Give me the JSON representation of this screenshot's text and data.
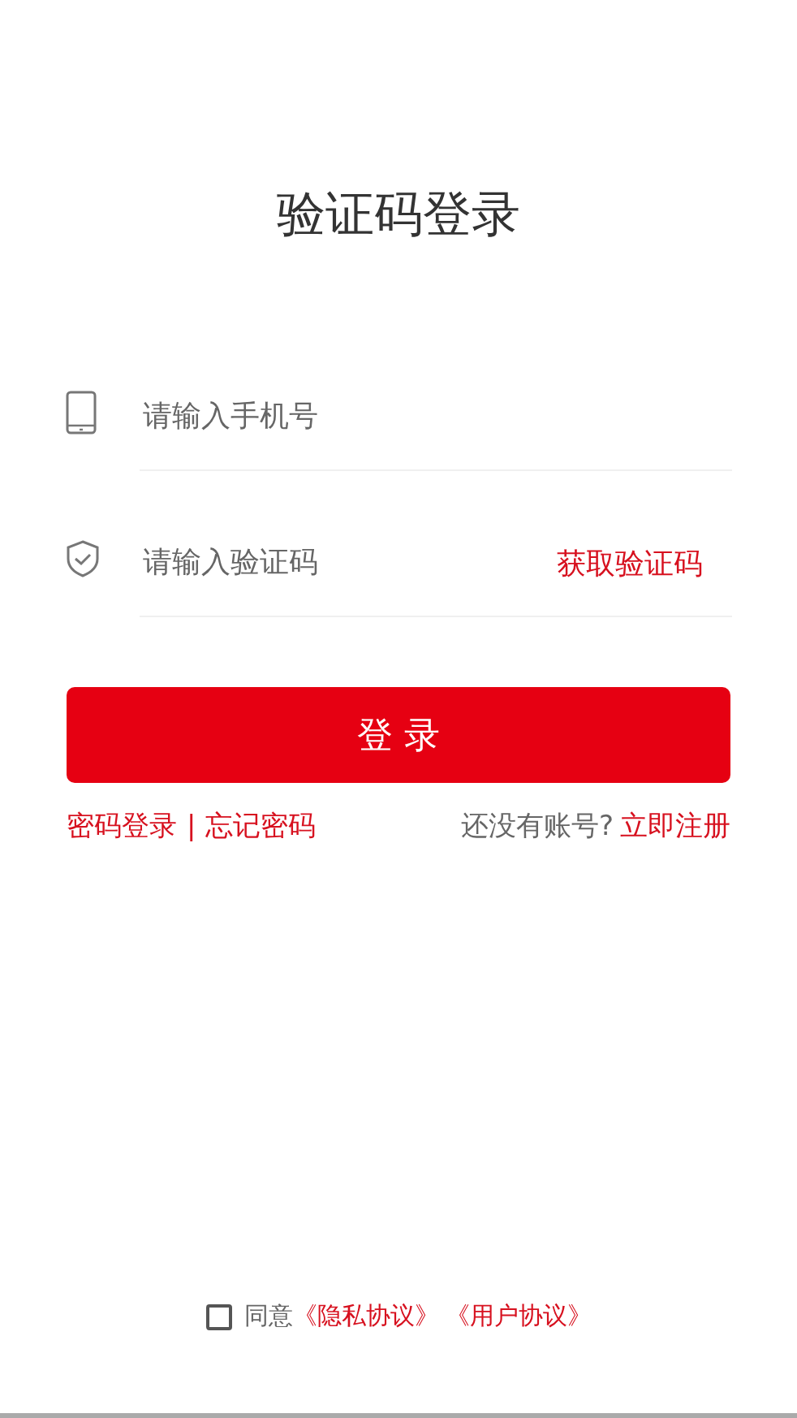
{
  "title": "验证码登录",
  "fields": [
    {
      "kind": "phone",
      "placeholder": "请输入手机号"
    },
    {
      "kind": "code",
      "placeholder": "请输入验证码",
      "action": "获取验证码"
    }
  ],
  "login_button": "登 录",
  "links_left": [
    {
      "label": "密码登录"
    },
    {
      "label": "|"
    },
    {
      "label": "忘记密码"
    }
  ],
  "no_account": "还没有账号?",
  "register": "立即注册",
  "agreement": {
    "checked": false,
    "prefix": "同意",
    "links": [
      "《隐私协议》",
      "《用户协议》"
    ]
  }
}
